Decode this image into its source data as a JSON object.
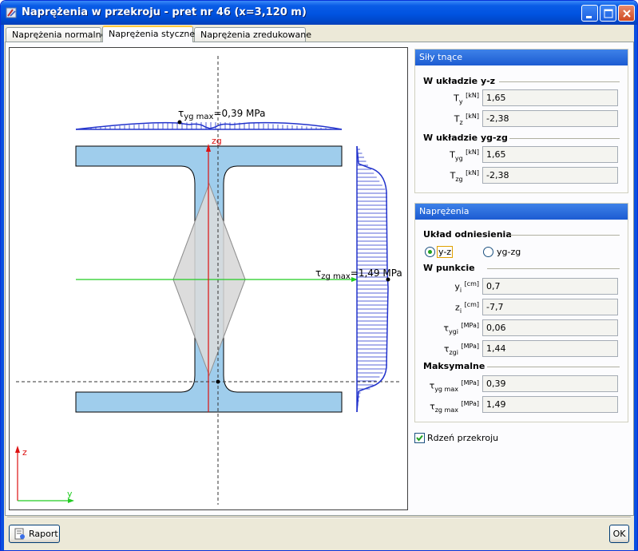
{
  "window": {
    "title": "Naprężenia w przekroju - pret nr 46 (x=3,120 m)"
  },
  "tabs": [
    {
      "label": "Naprężenia normalne",
      "active": false
    },
    {
      "label": "Naprężenia styczne",
      "active": true
    },
    {
      "label": "Naprężenia zredukowane",
      "active": false
    }
  ],
  "drawing": {
    "tau_yg_label": "τ",
    "tau_yg_sub": "yg max",
    "tau_yg_value": "=0,39 MPa",
    "tau_zg_label": "τ",
    "tau_zg_sub": "zg max",
    "tau_zg_value": "=1,49 MPa",
    "axis_zg": "zg",
    "axis_z": "z",
    "axis_y": "y"
  },
  "shear_forces": {
    "header": "Siły tnące",
    "section_yz": "W układzie y-z",
    "section_ygzg": "W układzie yg-zg",
    "Ty": {
      "sym": "T",
      "sub": "y",
      "unit": "[kN]",
      "value": "1,65"
    },
    "Tz": {
      "sym": "T",
      "sub": "z",
      "unit": "[kN]",
      "value": "-2,38"
    },
    "Tyg": {
      "sym": "T",
      "sub": "yg",
      "unit": "[kN]",
      "value": "1,65"
    },
    "Tzg": {
      "sym": "T",
      "sub": "zg",
      "unit": "[kN]",
      "value": "-2,38"
    }
  },
  "stresses": {
    "header": "Naprężenia",
    "reference": "Układ odniesienia",
    "radio_yz": "y-z",
    "radio_ygzg": "yg-zg",
    "at_point": "W punkcie",
    "yi": {
      "sym": "y",
      "sub": "i",
      "unit": "[cm]",
      "value": "0,7"
    },
    "zi": {
      "sym": "z",
      "sub": "i",
      "unit": "[cm]",
      "value": "-7,7"
    },
    "tygi": {
      "sym": "τ",
      "sub": "ygi",
      "unit": "[MPa]",
      "value": "0,06"
    },
    "tzgi": {
      "sym": "τ",
      "sub": "zgi",
      "unit": "[MPa]",
      "value": "1,44"
    },
    "maximal": "Maksymalne",
    "tygmax": {
      "sym": "τ",
      "sub": "yg max",
      "unit": "[MPa]",
      "value": "0,39"
    },
    "tzgmax": {
      "sym": "τ",
      "sub": "zg max",
      "unit": "[MPa]",
      "value": "1,49"
    }
  },
  "core_checkbox": "Rdzeń przekroju",
  "buttons": {
    "report": "Raport",
    "ok": "OK"
  },
  "colors": {
    "section_fill": "#9fcdec",
    "diagram": "#2233cc",
    "axis_red": "#dd1111",
    "axis_green": "#22cc22",
    "core_fill": "#dcdcdc"
  }
}
